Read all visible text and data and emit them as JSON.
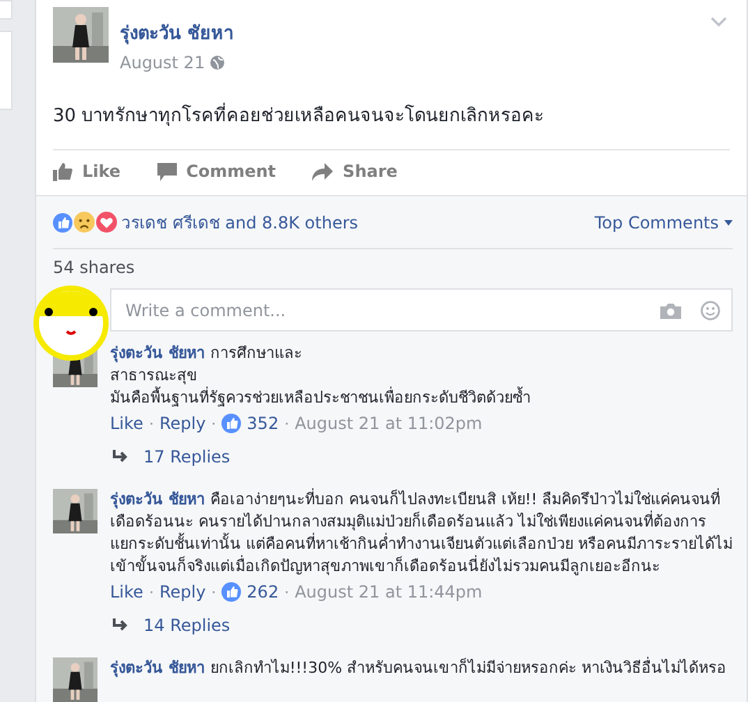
{
  "post": {
    "author": "รุ่งตะวัน ชัยหา",
    "date": "August 21",
    "text": "30 บาทรักษาทุกโรคที่คอยช่วยเหลือคนจนจะโดนยกเลิกหรอคะ",
    "actions": [
      {
        "kind": "like",
        "label": "Like"
      },
      {
        "kind": "comment",
        "label": "Comment"
      },
      {
        "kind": "share",
        "label": "Share"
      }
    ]
  },
  "reactions": {
    "summary": "วรเดช ศรีเดช and 8.8K others",
    "sort": "Top Comments"
  },
  "shares": "54 shares",
  "separator": "·",
  "comment_box": {
    "placeholder": "Write a comment..."
  },
  "comments": [
    {
      "author": "รุ่งตะวัน ชัยหา",
      "text": "การศึกษาและ\nสาธารณะสุข\nมันคือพื้นฐานที่รัฐควรช่วยเหลือประชาชนเพื่อยกระดับชีวิตด้วยซ้ำ",
      "like": "Like",
      "reply": "Reply",
      "likes": "352",
      "time": "August 21 at 11:02pm",
      "replies": "17 Replies"
    },
    {
      "author": "รุ่งตะวัน ชัยหา",
      "text": "คือเอาง่ายๆนะที่บอก คนจนก็ไปลงทะเบียนสิ เห้ย!! ลืมคิดรึป่าวไม่ใช่แค่คนจนที่เดือดร้อนนะ คนรายได้ปานกลางสมมุติแม่ป่วยก็เดือดร้อนแล้ว ไม่ใช่เพียงแค่คนจนที่ต้องการแยกระดับชั้นเท่านั้น แต่คือคนที่หาเช้ากินค่ำทำงานเจียนตัวแต่เลือกป่วย หรือคนมีภาระรายได้ไม่เข้าขั้นจนก็จริงแต่เมื่อเกิดปัญหาสุขภาพเขาก็เดือดร้อนนี่ยังไม่รวมคนมีลูกเยอะอีกนะ",
      "like": "Like",
      "reply": "Reply",
      "likes": "262",
      "time": "August 21 at 11:44pm",
      "replies": "14 Replies"
    },
    {
      "author": "รุ่งตะวัน ชัยหา",
      "text": "ยกเลิกทำไม!!!30% สำหรับคนจนเขาก็ไม่มีจ่ายหรอกค่ะ หาเงินวิธีอื่นไม่ได้หรอ"
    }
  ]
}
